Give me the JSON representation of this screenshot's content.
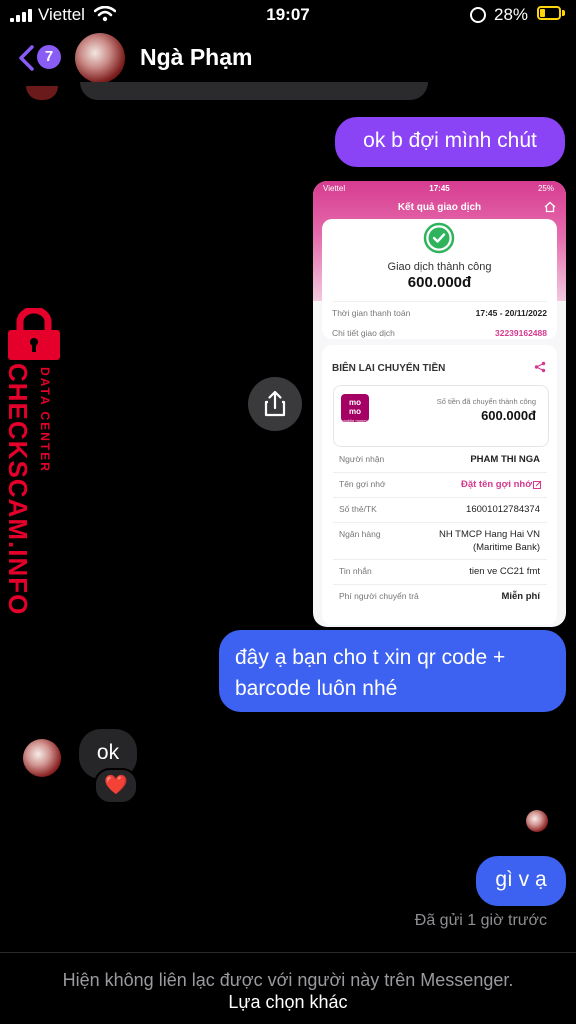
{
  "status_bar": {
    "carrier": "Viettel",
    "time": "19:07",
    "battery": "28%",
    "battery_level": 0.28
  },
  "header": {
    "back_badge": "7",
    "contact_name": "Ngà Phạm"
  },
  "messages": {
    "sent_1": "ok b đợi mình chút",
    "sent_2": "đây ạ bạn cho t xin qr code + barcode luôn nhé",
    "received_1": "ok",
    "received_1_reaction": "❤️",
    "sent_3": "gì v ạ",
    "sent_status": "Đã gửi 1 giờ trước"
  },
  "receipt": {
    "status_carrier": "Viettel",
    "status_time": "17:45",
    "status_battery": "25%",
    "title": "Kết quả giao dịch",
    "result": "Giao dịch thành công",
    "amount": "600.000đ",
    "payment_time_label": "Thời gian thanh toán",
    "payment_time_value": "17:45 - 20/11/2022",
    "detail_label": "Chi tiết giao dịch",
    "detail_value": "32239162488",
    "section_title": "BIÊN LAI CHUYỂN TIỀN",
    "momo_logo_top": "mo",
    "momo_logo_bottom": "mo",
    "momo_logo_small": "mobile money",
    "transferred_label": "Số tiền đã chuyển thành công",
    "transferred_amount": "600.000đ",
    "rows": [
      {
        "label": "Người nhận",
        "value": "PHAM THI NGA"
      },
      {
        "label": "Tên gợi nhớ",
        "value": "Đặt tên gợi nhớ"
      },
      {
        "label": "Số thẻ/TK",
        "value": "16001012784374"
      },
      {
        "label": "Ngân hàng",
        "value": "NH TMCP Hang Hai VN (Maritime Bank)"
      },
      {
        "label": "Tin nhắn",
        "value": "tien ve CC21 fmt"
      },
      {
        "label": "Phí người chuyển trả",
        "value": "Miễn phí"
      }
    ]
  },
  "watermark": {
    "main": "CHECKSCAM.INFO",
    "sub": "DATA CENTER"
  },
  "footer": {
    "notice": "Hiện không liên lạc được với người này trên Messenger.",
    "link": "Lựa chọn khác"
  },
  "colors": {
    "sent_purple": "#8a43f5",
    "sent_blue": "#3d62f2",
    "received_gray": "#262629",
    "watermark_red": "#e4002b",
    "momo_pink": "#a50064"
  }
}
